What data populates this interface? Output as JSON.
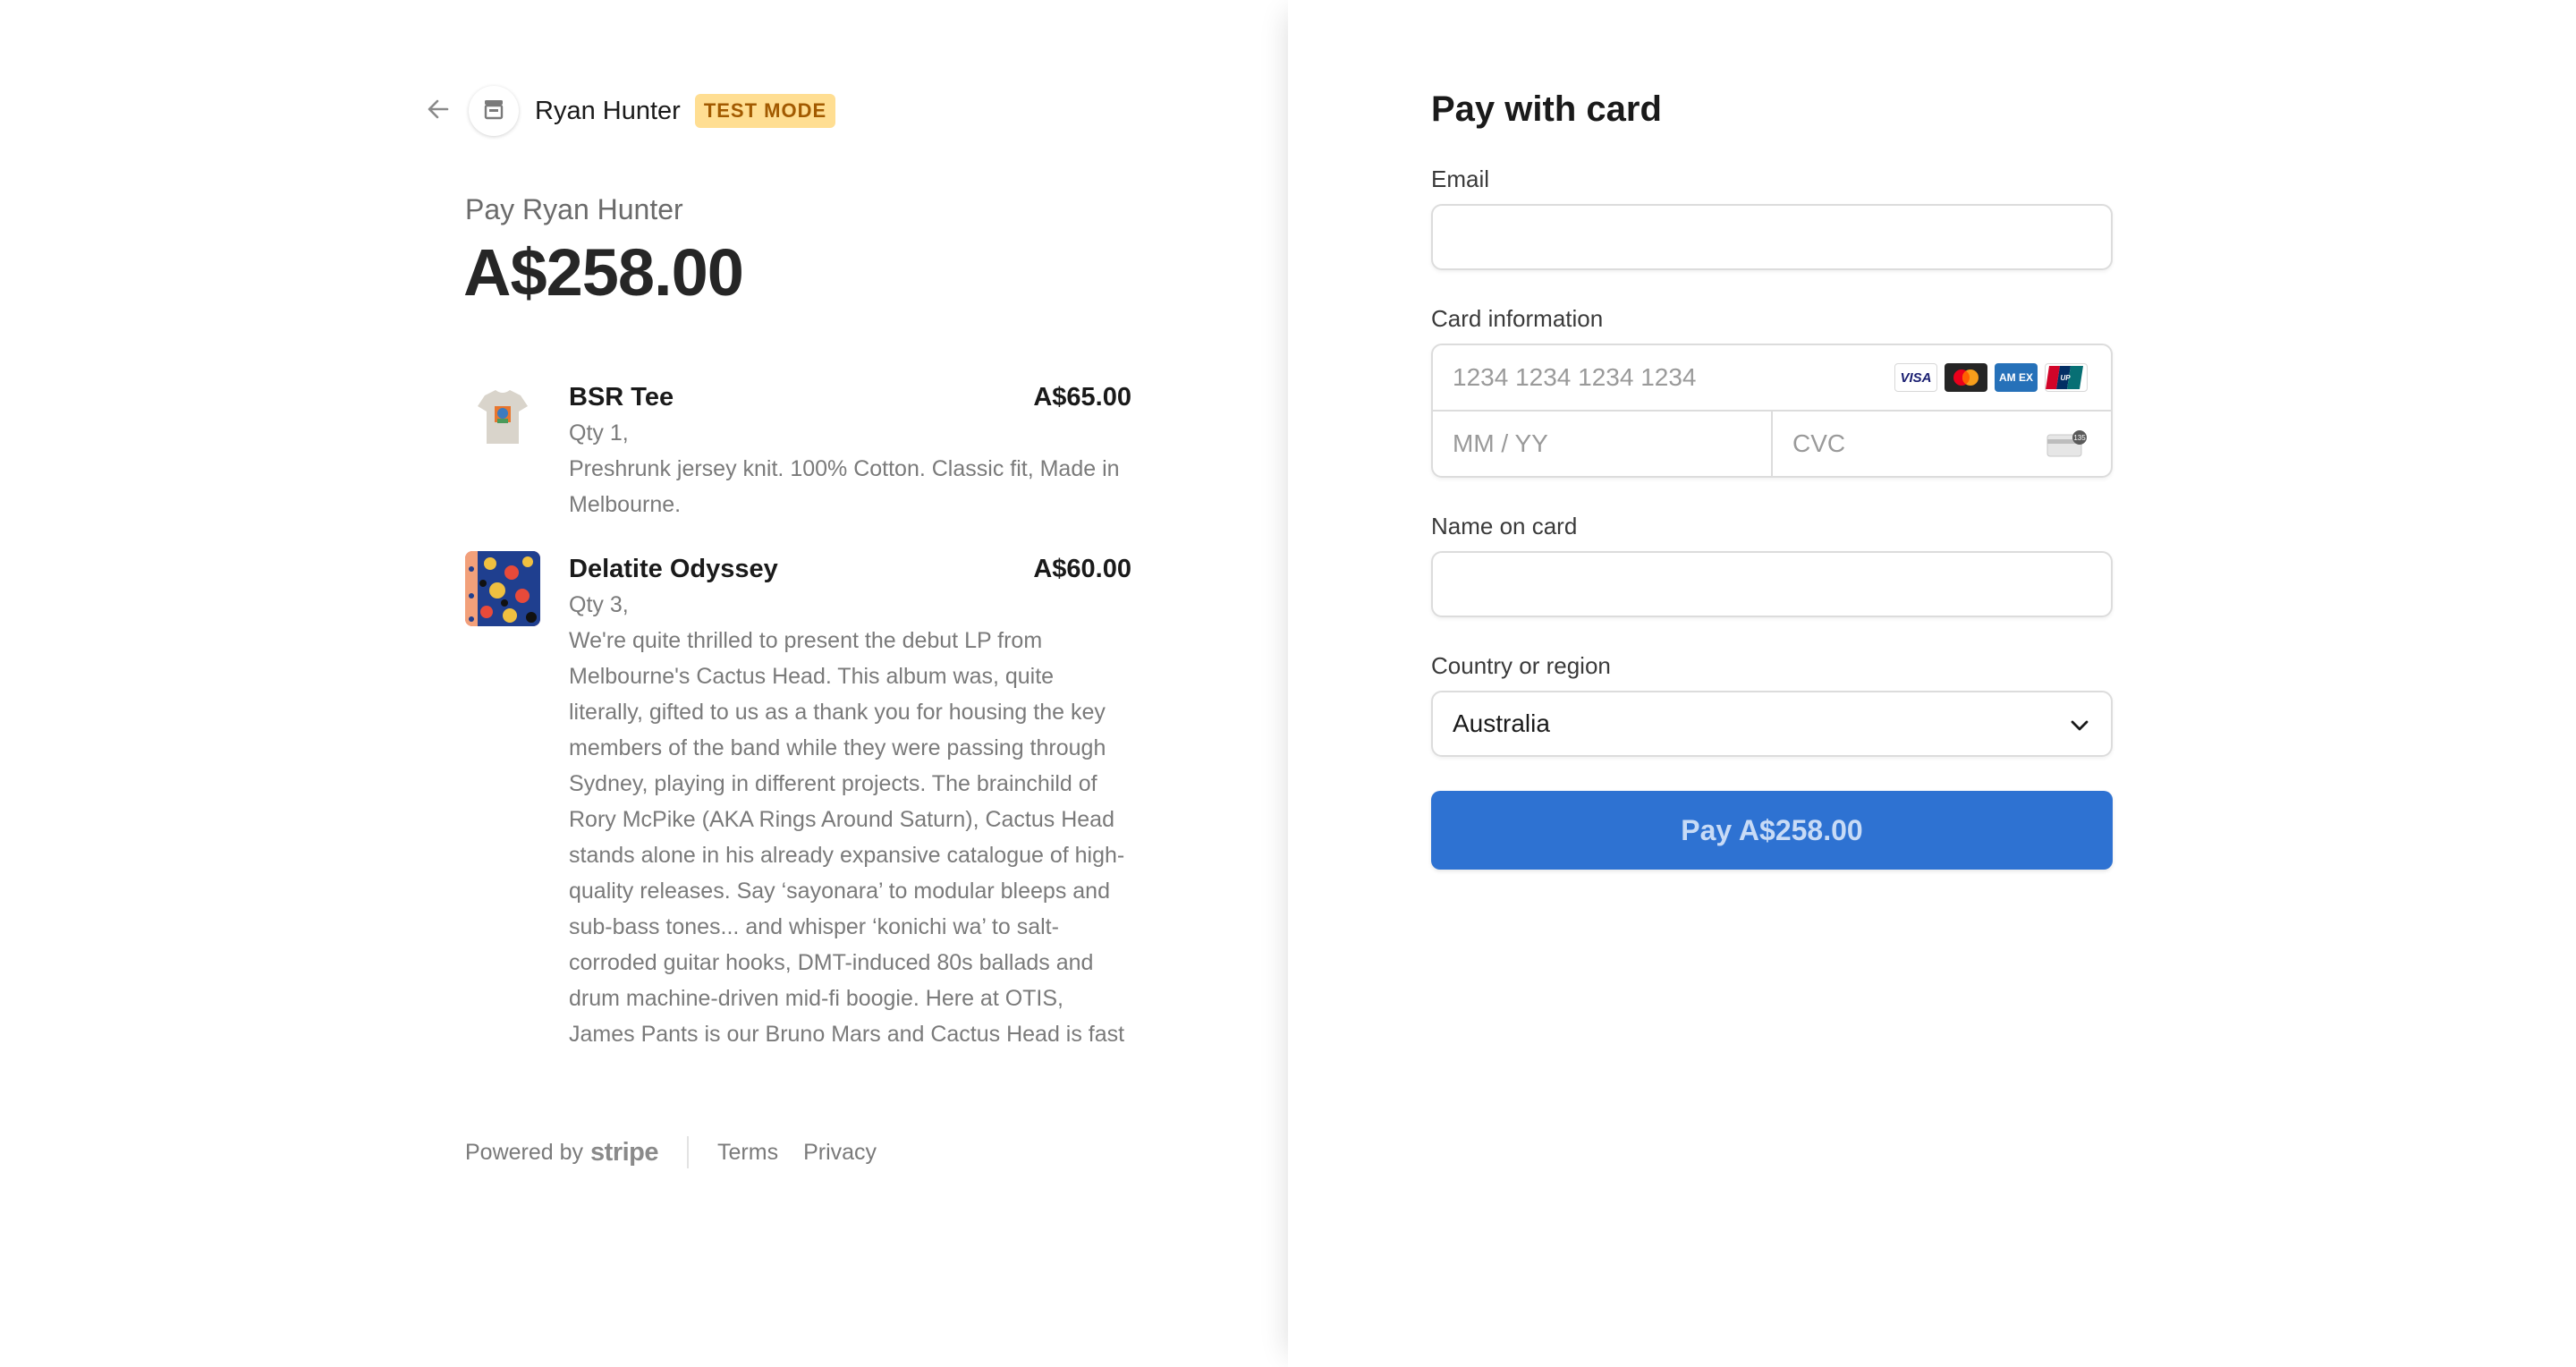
{
  "merchant": {
    "name": "Ryan Hunter",
    "badge": "TEST MODE"
  },
  "summary": {
    "pay_to": "Pay Ryan Hunter",
    "total": "A$258.00"
  },
  "items": [
    {
      "title": "BSR Tee",
      "price": "A$65.00",
      "qty": "Qty 1,",
      "description": "Preshrunk jersey knit. 100% Cotton. Classic fit, Made in Melbourne."
    },
    {
      "title": "Delatite Odyssey",
      "price": "A$60.00",
      "qty": "Qty 3,",
      "description": "We're quite thrilled to present the debut LP from Melbourne's Cactus Head. This album was, quite literally, gifted to us as a thank you for housing the key members of the band while they were passing through Sydney, playing in different projects. The brainchild of Rory McPike (AKA Rings Around Saturn), Cactus Head stands alone in his already expansive catalogue of high-quality releases. Say ‘sayonara’ to modular bleeps and sub-bass tones... and whisper ‘konichi wa’ to salt-corroded guitar hooks, DMT-induced 80s ballads and drum machine-driven mid-fi boogie. Here at OTIS, James Pants is our Bruno Mars and Cactus Head is fast"
    }
  ],
  "footer": {
    "powered_by": "Powered by",
    "brand": "stripe",
    "terms": "Terms",
    "privacy": "Privacy"
  },
  "form": {
    "title": "Pay with card",
    "email_label": "Email",
    "email_value": "",
    "card_label": "Card information",
    "card_number_placeholder": "1234 1234 1234 1234",
    "expiry_placeholder": "MM / YY",
    "cvc_placeholder": "CVC",
    "card_brands": [
      "visa-logo",
      "mastercard-logo",
      "amex-logo",
      "unionpay-logo"
    ],
    "name_label": "Name on card",
    "name_value": "",
    "country_label": "Country or region",
    "country_value": "Australia",
    "pay_button": "Pay A$258.00"
  },
  "colors": {
    "accent": "#2e72d2",
    "badge_bg": "#ffde92",
    "badge_text": "#a25a00"
  }
}
